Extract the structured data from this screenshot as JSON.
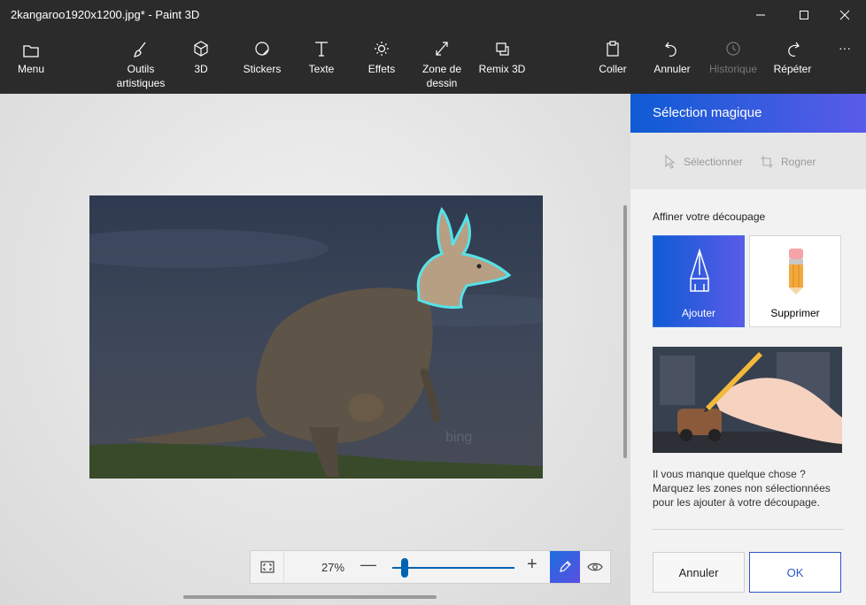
{
  "window": {
    "title": "2kangaroo1920x1200.jpg* - Paint 3D",
    "controls": {
      "minimize": "minimize-icon",
      "maximize": "maximize-icon",
      "close": "close-icon"
    }
  },
  "toolbar": {
    "menu": "Menu",
    "tools": [
      {
        "label1": "Outils",
        "label2": "artistiques",
        "icon": "brush-icon"
      },
      {
        "label1": "3D",
        "label2": "",
        "icon": "cube-icon"
      },
      {
        "label1": "Stickers",
        "label2": "",
        "icon": "sticker-icon"
      },
      {
        "label1": "Texte",
        "label2": "",
        "icon": "text-icon"
      },
      {
        "label1": "Effets",
        "label2": "",
        "icon": "sun-icon"
      },
      {
        "label1": "Zone de",
        "label2": "dessin",
        "icon": "canvas-icon"
      },
      {
        "label1": "Remix 3D",
        "label2": "",
        "icon": "remix-icon"
      }
    ],
    "paste": "Coller",
    "undo": "Annuler",
    "history": "Historique",
    "redo": "Répéter",
    "more": "···"
  },
  "zoom": {
    "percent": "27%",
    "level": 0.27,
    "minus": "—",
    "plus": "+"
  },
  "watermark": "bing",
  "panel": {
    "title": "Sélection magique",
    "select": "Sélectionner",
    "crop": "Rogner",
    "refine_label": "Affiner votre découpage",
    "add": "Ajouter",
    "remove": "Supprimer",
    "help_line1": "Il vous manque quelque chose ?",
    "help_line2": "Marquez les zones non sélectionnées",
    "help_line3": "pour les ajouter à votre découpage.",
    "cancel": "Annuler",
    "ok": "OK"
  },
  "colors": {
    "accent": "#0f5bd4",
    "accent2": "#5a5be8",
    "dark": "#2b2b2b"
  }
}
